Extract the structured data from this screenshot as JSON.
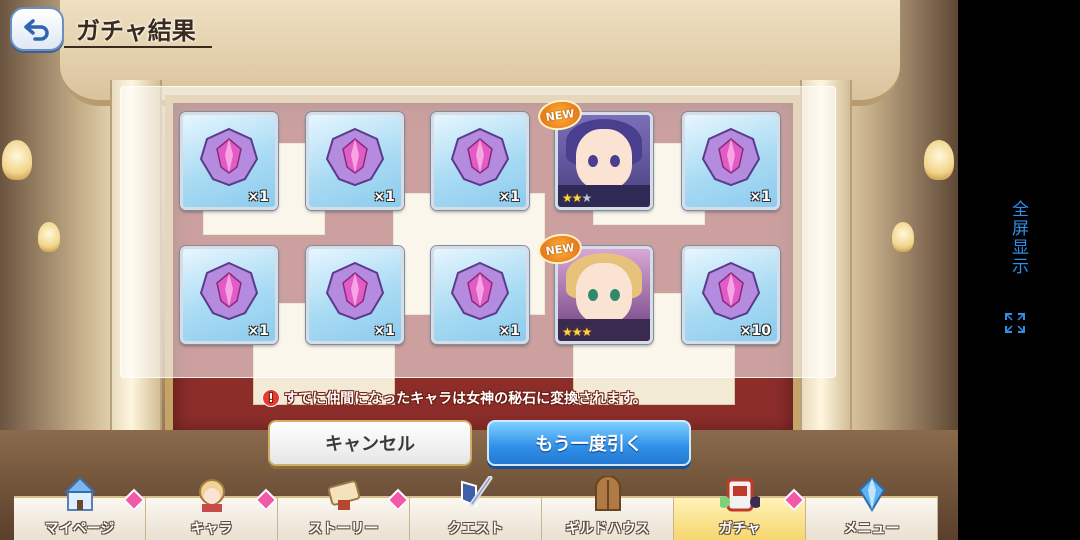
{
  "header": {
    "title": "ガチャ結果"
  },
  "results": [
    {
      "type": "item",
      "qty": "×1"
    },
    {
      "type": "item",
      "qty": "×1"
    },
    {
      "type": "item",
      "qty": "×1"
    },
    {
      "type": "character",
      "badge": "NEW",
      "stars": "★★",
      "dim_stars": "★"
    },
    {
      "type": "item",
      "qty": "×1"
    },
    {
      "type": "item",
      "qty": "×1"
    },
    {
      "type": "item",
      "qty": "×1"
    },
    {
      "type": "item",
      "qty": "×1"
    },
    {
      "type": "character",
      "badge": "NEW",
      "stars": "★★★",
      "dim_stars": ""
    },
    {
      "type": "item",
      "qty": "×10"
    }
  ],
  "notice": {
    "text": "すでに仲間になったキャラは女神の秘石に変換されます。",
    "icon": "!"
  },
  "buttons": {
    "cancel": "キャンセル",
    "draw_again": "もう一度引く"
  },
  "nav": [
    {
      "label": "マイページ",
      "icon": "castle-icon",
      "dot": true
    },
    {
      "label": "キャラ",
      "icon": "character-icon",
      "dot": true
    },
    {
      "label": "ストーリー",
      "icon": "scroll-icon",
      "dot": true
    },
    {
      "label": "クエスト",
      "icon": "sword-shield-icon",
      "dot": false
    },
    {
      "label": "ギルドハウス",
      "icon": "door-icon",
      "dot": false
    },
    {
      "label": "ガチャ",
      "icon": "gacha-icon",
      "dot": true,
      "active": true
    },
    {
      "label": "メニュー",
      "icon": "crystal-icon",
      "dot": false
    }
  ],
  "side": {
    "fullscreen_label": "全屏显示"
  },
  "colors": {
    "accent_blue": "#2f8fe8",
    "nav_active": "#f6d56a",
    "notice_red": "#e63b2e"
  }
}
